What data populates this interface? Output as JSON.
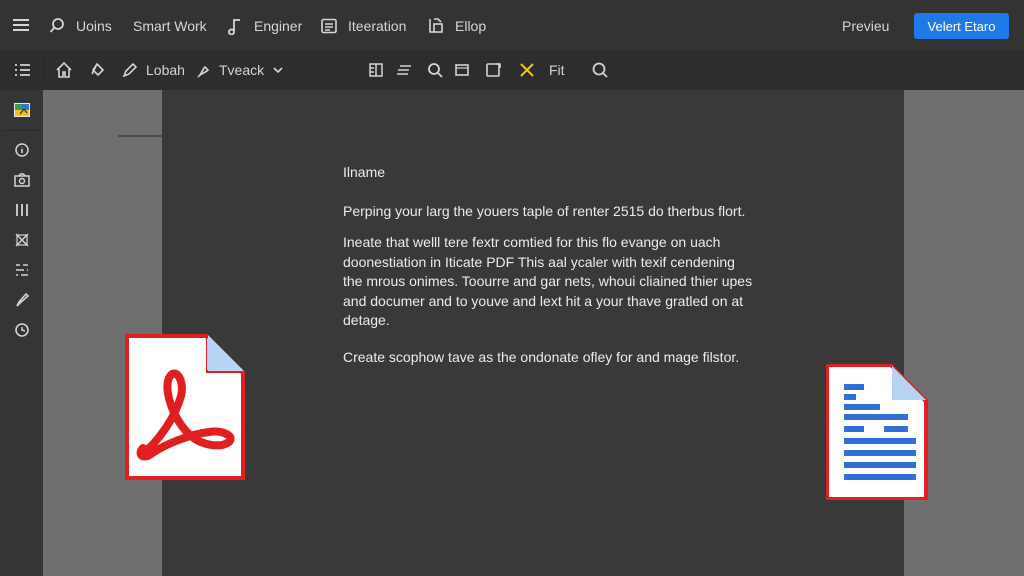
{
  "nav": {
    "items": [
      {
        "label": "Uoins",
        "icon": "search-icon"
      },
      {
        "label": "Smart Work",
        "icon": null
      },
      {
        "label": "Enginer",
        "icon": "music-note-icon"
      },
      {
        "label": "Iteeration",
        "icon": "document-list-icon"
      },
      {
        "label": "Ellop",
        "icon": "export-icon"
      }
    ],
    "preview_label": "Previeu",
    "primary_label": "Velert Etaro"
  },
  "toolbar": {
    "tool1_label": "Lobah",
    "tool2_label": "Tveack",
    "fit_label": "Fit",
    "pause_label": "!!",
    "accent_color": "#f2c418"
  },
  "document": {
    "heading": "Ilname",
    "p1": "Perping your larg the youers taple of renter 2515 do therbus flort.",
    "p2_lines": [
      "Ineate that welll tere fextr comtied for this flo evange on uach",
      "doonestiation in Iticate PDF This aal ycaler with texif cendening",
      "the mrous onimes. Toourre and gar nets, whoui cliained thier upes",
      "and documer and to youve and lext hit a your thave gratled on at",
      "detage."
    ],
    "p3": "Create scophow tave as the ondonate ofley for and mage filstor."
  },
  "colors": {
    "brand_blue": "#1f7ae8",
    "pdf_red": "#e02020",
    "doc_blue": "#2f6fd6"
  }
}
